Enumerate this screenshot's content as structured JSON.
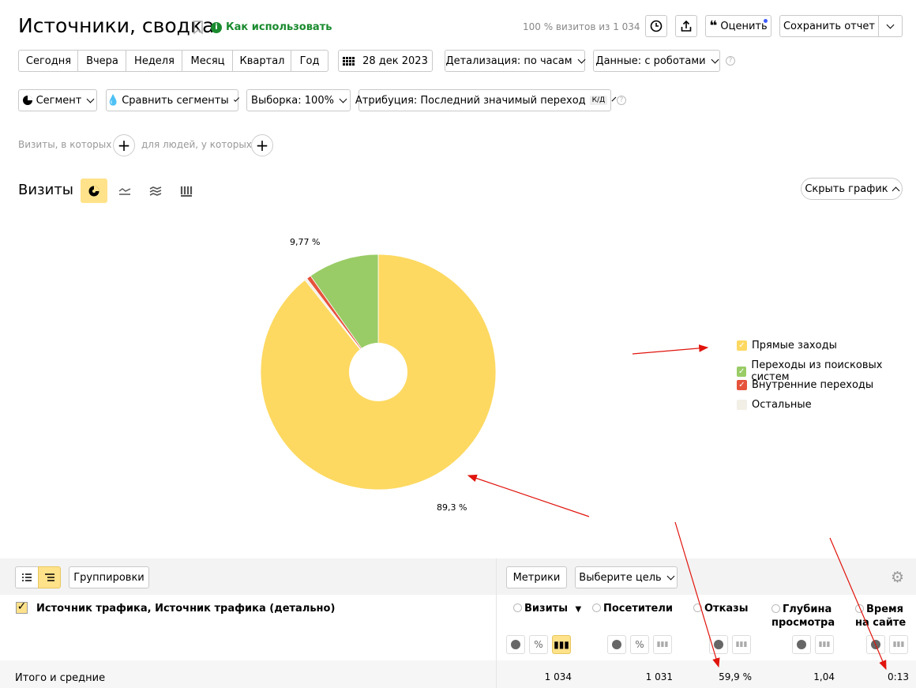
{
  "header": {
    "title": "Источники, сводка",
    "how_to": "Как использовать",
    "visits_share": "100 % визитов из 1 034",
    "rate": "Оценить",
    "save": "Сохранить отчет"
  },
  "periods": [
    "Сегодня",
    "Вчера",
    "Неделя",
    "Месяц",
    "Квартал",
    "Год"
  ],
  "date": "28 дек 2023",
  "detail": "Детализация: по часам",
  "data_mode": "Данные: с роботами",
  "filters": {
    "segment": "Сегмент",
    "compare": "Сравнить сегменты",
    "sample": "Выборка: 100%",
    "attribution": "Атрибуция: Последний значимый переход",
    "attribution_badge": "К/Д"
  },
  "conditions": {
    "visits": "Визиты, в которых",
    "people": "для людей, у которых"
  },
  "chart_section": {
    "title": "Визиты",
    "hide": "Скрыть график"
  },
  "chart_data": {
    "type": "pie",
    "categories": [
      "Прямые заходы",
      "Переходы из поисковых систем",
      "Внутренние переходы",
      "Остальные"
    ],
    "values": [
      89.3,
      9.77,
      0.6,
      0.33
    ],
    "labels": [
      "89,3 %",
      "9,77 %",
      "",
      ""
    ],
    "colors": [
      "#fdd962",
      "#99cc66",
      "#e6533c",
      "#f1efe6"
    ]
  },
  "table": {
    "groupings": "Группировки",
    "metrics": "Метрики",
    "goal": "Выберите цель",
    "dimension": "Источник трафика, Источник трафика (детально)",
    "columns": [
      {
        "l1": "Визиты",
        "l2": ""
      },
      {
        "l1": "Посетители",
        "l2": ""
      },
      {
        "l1": "Отказы",
        "l2": ""
      },
      {
        "l1": "Глубина",
        "l2": "просмотра"
      },
      {
        "l1": "Время",
        "l2": "на сайте"
      }
    ],
    "sort_mark": "▼",
    "total_label": "Итого и средние",
    "totals": [
      "1 034",
      "1 031",
      "59,9 %",
      "1,04",
      "0:13"
    ]
  }
}
